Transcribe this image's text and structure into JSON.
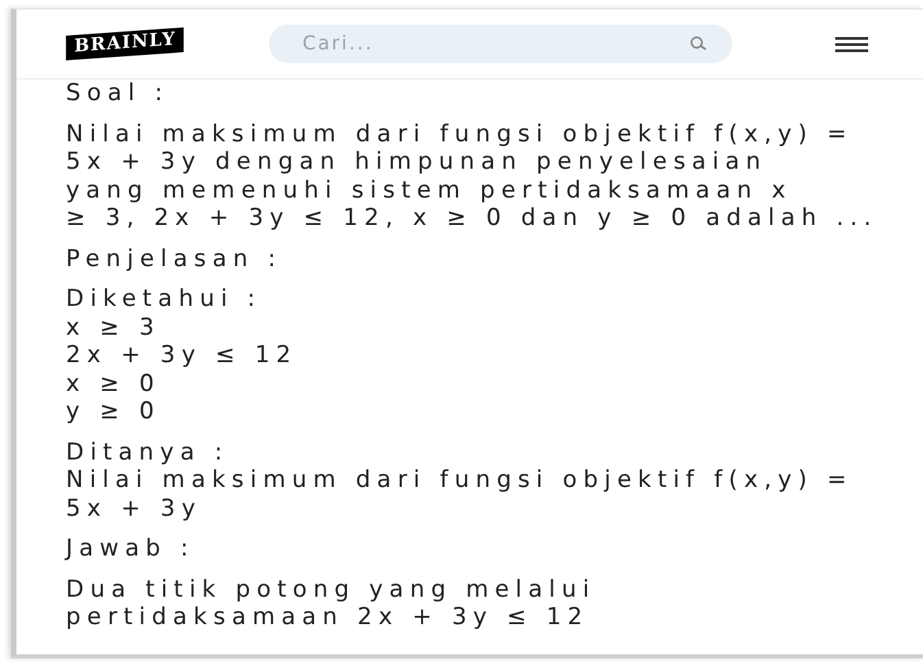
{
  "header": {
    "logo": "BRAINLY",
    "search": {
      "placeholder": "Cari..."
    }
  },
  "blocks": [
    {
      "lines": [
        "Soal :"
      ]
    },
    {
      "lines": [
        "Nilai maksimum dari fungsi objektif f(x,y) =",
        "5x + 3y dengan himpunan penyelesaian",
        "yang memenuhi sistem pertidaksamaan x",
        "≥ 3, 2x + 3y ≤ 12, x ≥ 0 dan y ≥ 0 adalah ..."
      ]
    },
    {
      "lines": [
        "Penjelasan :"
      ]
    },
    {
      "lines": [
        "Diketahui :",
        "x ≥ 3",
        "2x + 3y ≤ 12",
        "x ≥ 0",
        "y ≥ 0"
      ]
    },
    {
      "lines": [
        "Ditanya :",
        "Nilai maksimum dari fungsi objektif f(x,y) =",
        "5x + 3y"
      ]
    },
    {
      "lines": [
        "Jawab :"
      ]
    },
    {
      "lines": [
        "Dua titik potong yang melalui",
        "pertidaksamaan 2x + 3y ≤ 12"
      ]
    }
  ]
}
